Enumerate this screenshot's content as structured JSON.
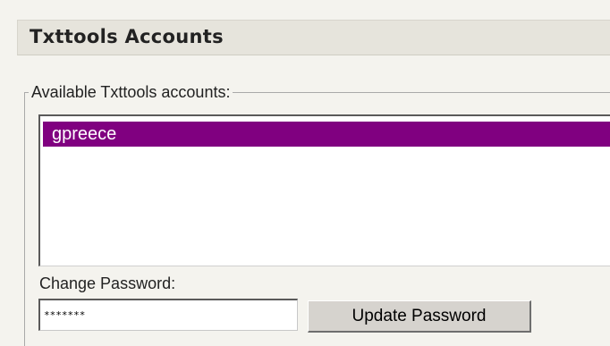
{
  "header": {
    "title": "Txttools Accounts"
  },
  "accounts": {
    "legend": "Available Txttools accounts:",
    "items": [
      {
        "label": "gpreece",
        "selected": true
      }
    ]
  },
  "password": {
    "label": "Change Password:",
    "value": "*******",
    "update_label": "Update Password"
  },
  "colors": {
    "selection": "#800080",
    "selection_text": "#ffffff",
    "header_bar": "#e6e4dc",
    "panel_background": "#f4f3ee"
  }
}
